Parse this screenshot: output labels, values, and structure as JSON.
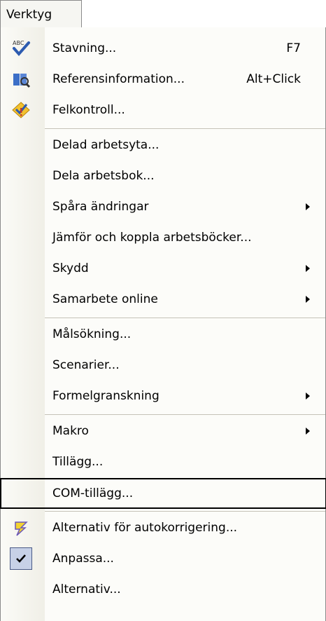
{
  "menubar": {
    "title": "Verktyg"
  },
  "menu": {
    "items": [
      {
        "label": "Stavning...",
        "shortcut": "F7",
        "icon": "spelling-abc-icon"
      },
      {
        "label": "Referensinformation...",
        "shortcut": "Alt+Click",
        "icon": "research-book-icon"
      },
      {
        "label": "Felkontroll...",
        "icon": "error-check-icon"
      },
      {
        "label": "Delad arbetsyta..."
      },
      {
        "label": "Dela arbetsbok..."
      },
      {
        "label": "Spåra ändringar",
        "submenu": true
      },
      {
        "label": "Jämför och koppla arbetsböcker..."
      },
      {
        "label": "Skydd",
        "submenu": true
      },
      {
        "label": "Samarbete online",
        "submenu": true
      },
      {
        "label": "Målsökning..."
      },
      {
        "label": "Scenarier..."
      },
      {
        "label": "Formelgranskning",
        "submenu": true
      },
      {
        "label": "Makro",
        "submenu": true
      },
      {
        "label": "Tillägg..."
      },
      {
        "label": "COM-tillägg...",
        "focused": true
      },
      {
        "label": "Alternativ för autokorrigering...",
        "icon": "autocorrect-lightning-icon"
      },
      {
        "label": "Anpassa...",
        "icon": "checkmark-icon",
        "checked": true
      },
      {
        "label": "Alternativ..."
      }
    ]
  },
  "colors": {
    "gutter": "#f0efe7",
    "checked_bg": "#c7d1e7",
    "separator": "#c5c2b8"
  }
}
